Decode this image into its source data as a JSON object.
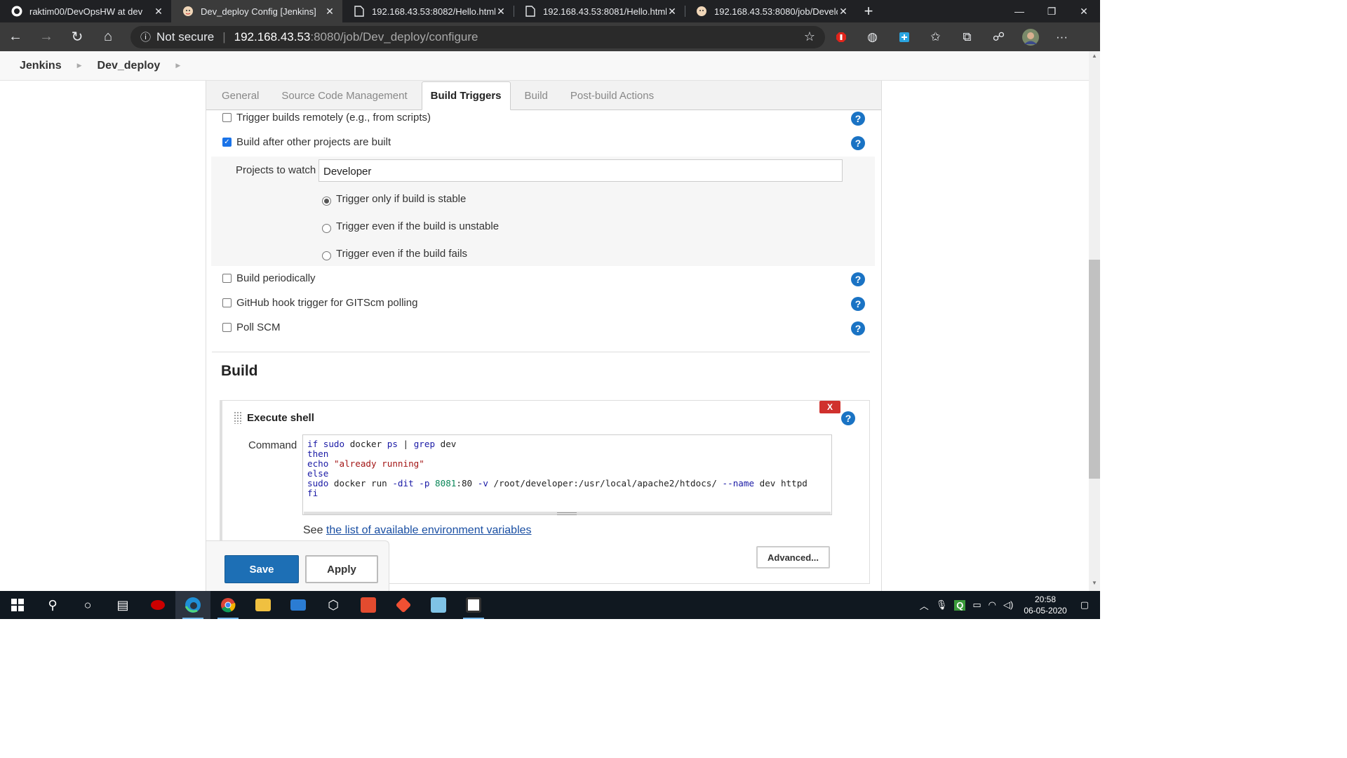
{
  "browser": {
    "tabs": [
      {
        "title": "raktim00/DevOpsHW at dev",
        "icon": "github-icon"
      },
      {
        "title": "Dev_deploy Config [Jenkins]",
        "icon": "jenkins-icon"
      },
      {
        "title": "192.168.43.53:8082/Hello.html",
        "icon": "page-icon"
      },
      {
        "title": "192.168.43.53:8081/Hello.html",
        "icon": "page-icon"
      },
      {
        "title": "192.168.43.53:8080/job/Develop",
        "icon": "jenkins-icon"
      }
    ],
    "close_glyph": "✕",
    "newtab_glyph": "+",
    "address": {
      "security": "Not secure",
      "host": "192.168.43.53",
      "path": ":8080/job/Dev_deploy/configure"
    }
  },
  "breadcrumb": {
    "root": "Jenkins",
    "job": "Dev_deploy"
  },
  "config_tabs": [
    "General",
    "Source Code Management",
    "Build Triggers",
    "Build",
    "Post-build Actions"
  ],
  "active_tab": "Build Triggers",
  "triggers": {
    "remote": {
      "label": "Trigger builds remotely (e.g., from scripts)",
      "checked": false
    },
    "after_other": {
      "label": "Build after other projects are built",
      "checked": true
    },
    "projects_label": "Projects to watch",
    "projects_value": "Developer",
    "options": [
      {
        "label": "Trigger only if build is stable",
        "selected": true
      },
      {
        "label": "Trigger even if the build is unstable",
        "selected": false
      },
      {
        "label": "Trigger even if the build fails",
        "selected": false
      }
    ],
    "periodic": {
      "label": "Build periodically",
      "checked": false
    },
    "github": {
      "label": "GitHub hook trigger for GITScm polling",
      "checked": false
    },
    "poll": {
      "label": "Poll SCM",
      "checked": false
    },
    "help_glyph": "?"
  },
  "build": {
    "section_title": "Build",
    "step_title": "Execute shell",
    "delete_label": "X",
    "command_label": "Command",
    "command_lines": [
      "if sudo docker ps | grep dev",
      "then",
      "echo \"already running\"",
      "else",
      "sudo docker run -dit -p 8081:80 -v /root/developer:/usr/local/apache2/htdocs/ --name dev httpd",
      "fi"
    ],
    "see_prefix": "See ",
    "see_link": "the list of available environment variables",
    "advanced_label": "Advanced..."
  },
  "buttons": {
    "save": "Save",
    "apply": "Apply"
  },
  "taskbar": {
    "time": "20:58",
    "date": "06-05-2020"
  },
  "colors": {
    "accent": "#1d6fb5",
    "help": "#1a73c4",
    "delete": "#d0312d",
    "link": "#1a4fa3"
  }
}
